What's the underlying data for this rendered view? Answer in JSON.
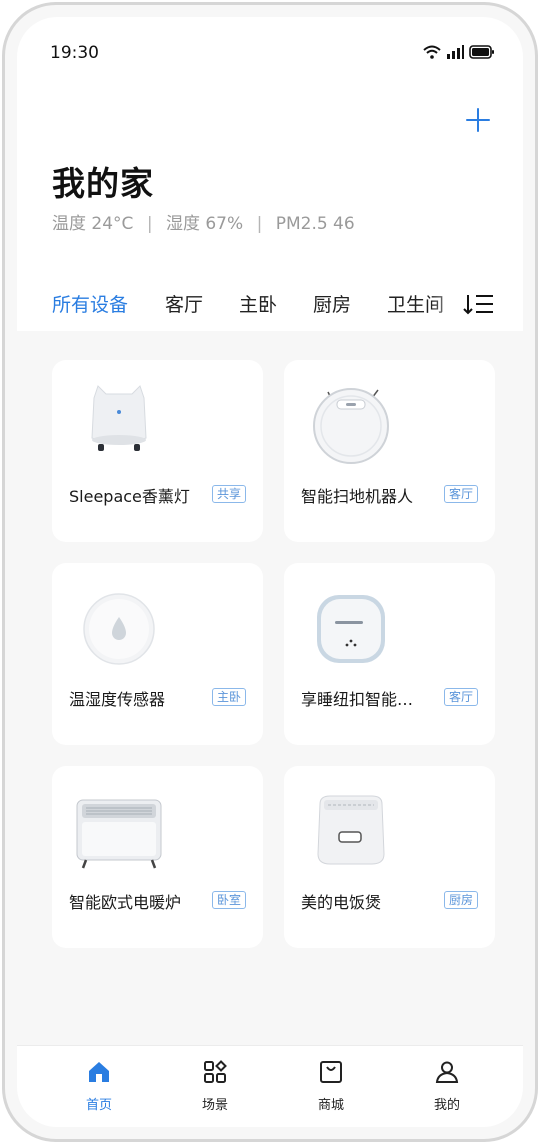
{
  "status_bar": {
    "time": "19:30"
  },
  "header": {
    "title": "我的家",
    "temperature": "温度  24°C",
    "humidity": "湿度 67%",
    "pm25": "PM2.5   46",
    "separator": "|"
  },
  "room_tabs": [
    {
      "label": "所有设备",
      "active": true
    },
    {
      "label": "客厅",
      "active": false
    },
    {
      "label": "主卧",
      "active": false
    },
    {
      "label": "厨房",
      "active": false
    },
    {
      "label": "卫生间",
      "active": false
    }
  ],
  "devices": [
    {
      "name": "Sleepace香薰灯",
      "tag": "共享",
      "icon": "aroma-lamp-icon"
    },
    {
      "name": "智能扫地机器人",
      "tag": "客厅",
      "icon": "robot-vacuum-icon"
    },
    {
      "name": "温湿度传感器",
      "tag": "主卧",
      "icon": "humidity-sensor-icon"
    },
    {
      "name": "享睡纽扣智能…",
      "tag": "客厅",
      "icon": "sleep-button-icon"
    },
    {
      "name": "智能欧式电暖炉",
      "tag": "卧室",
      "icon": "electric-heater-icon"
    },
    {
      "name": "美的电饭煲",
      "tag": "厨房",
      "icon": "rice-cooker-icon"
    }
  ],
  "bottom_nav": [
    {
      "label": "首页",
      "icon": "home-icon",
      "active": true
    },
    {
      "label": "场景",
      "icon": "scenes-icon",
      "active": false
    },
    {
      "label": "商城",
      "icon": "mall-icon",
      "active": false
    },
    {
      "label": "我的",
      "icon": "profile-icon",
      "active": false
    }
  ],
  "colors": {
    "accent": "#2a7de1",
    "tag_border": "#8bb8ea",
    "background": "#f7f7f7"
  }
}
